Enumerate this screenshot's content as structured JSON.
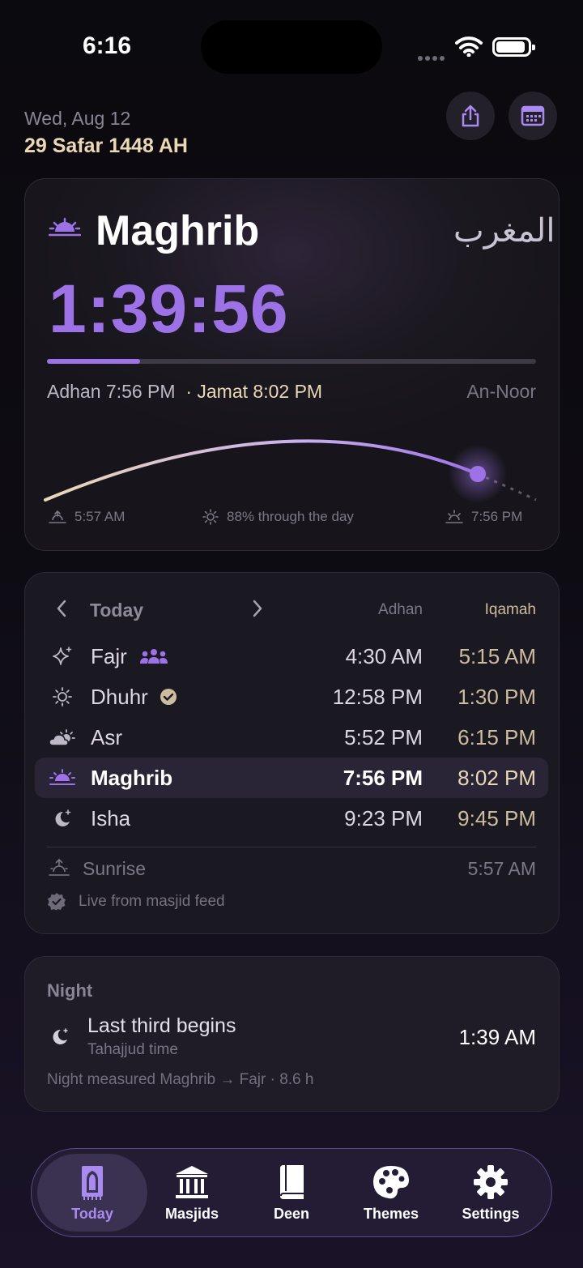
{
  "status_bar": {
    "time": "6:16"
  },
  "header": {
    "date": "Wed, Aug 12",
    "hijri_date": "29 Safar 1448 AH",
    "share_icon": "share-icon",
    "calendar_icon": "calendar-icon"
  },
  "current": {
    "prayer": "Maghrib",
    "prayer_arabic": "المغرب",
    "countdown": "1:39:56",
    "progress_fraction": 0.19,
    "adhan": "Adhan 7:56 PM",
    "jamat": "· Jamat 8:02 PM",
    "masjid": "An-Noor",
    "sunrise_time": "5:57 AM",
    "day_progress": "88% through the day",
    "sunset_time": "7:56 PM",
    "day_progress_fraction": 0.88
  },
  "schedule": {
    "day_label": "Today",
    "col_adhan": "Adhan",
    "col_iqamah": "Iqamah",
    "rows": [
      {
        "name": "Fajr",
        "adhan": "4:30 AM",
        "iqamah": "5:15 AM",
        "icon": "sparkle-icon",
        "badge": "congregation-icon"
      },
      {
        "name": "Dhuhr",
        "adhan": "12:58 PM",
        "iqamah": "1:30 PM",
        "icon": "sun-icon",
        "badge": "check-icon"
      },
      {
        "name": "Asr",
        "adhan": "5:52 PM",
        "iqamah": "6:15 PM",
        "icon": "cloud-sun-icon"
      },
      {
        "name": "Maghrib",
        "adhan": "7:56 PM",
        "iqamah": "8:02 PM",
        "icon": "sunset-icon",
        "active": true
      },
      {
        "name": "Isha",
        "adhan": "9:23 PM",
        "iqamah": "9:45 PM",
        "icon": "moon-star-icon"
      }
    ],
    "sunrise_label": "Sunrise",
    "sunrise_time": "5:57 AM",
    "live_label": "Live from masjid feed"
  },
  "night": {
    "title": "Night",
    "main": "Last third begins",
    "sub": "Tahajjud time",
    "time": "1:39 AM",
    "note": "Night measured Maghrib → Fajr · 8.6 h"
  },
  "tabs": [
    {
      "label": "Today",
      "icon": "prayer-mat-icon",
      "active": true
    },
    {
      "label": "Masjids",
      "icon": "building-icon"
    },
    {
      "label": "Deen",
      "icon": "book-icon"
    },
    {
      "label": "Themes",
      "icon": "palette-icon"
    },
    {
      "label": "Settings",
      "icon": "gear-icon"
    }
  ],
  "colors": {
    "accent": "#9d72e6",
    "gold": "#ead8b6",
    "background": "#0e0c13"
  }
}
